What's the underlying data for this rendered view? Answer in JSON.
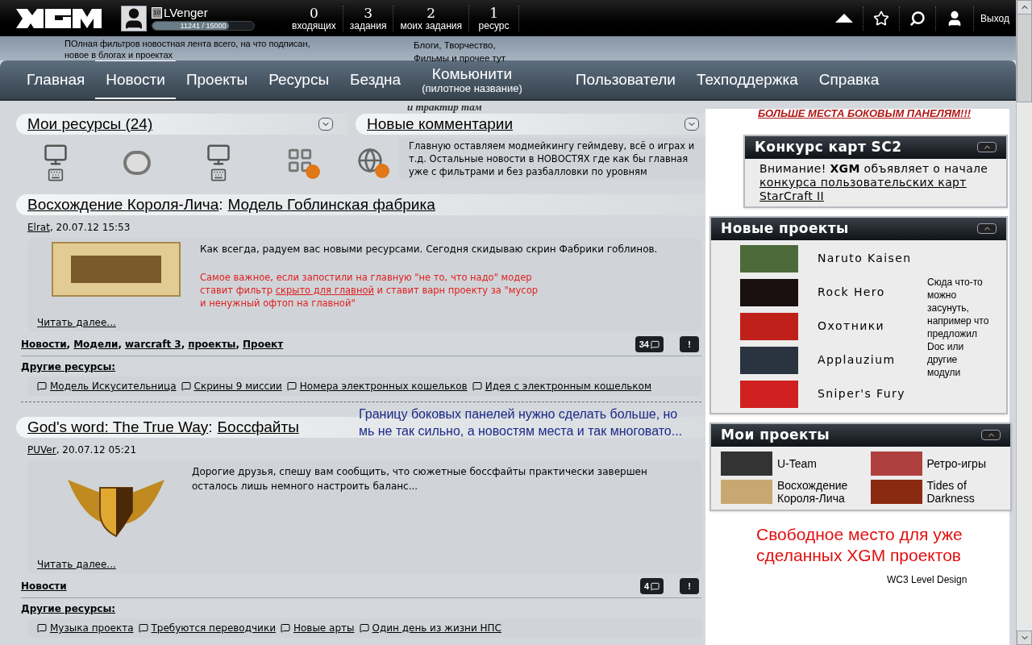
{
  "top_bar": {
    "user": {
      "name": "LVenger",
      "level_badge": "10",
      "xp": "11241 / 15000",
      "level": 0.75
    },
    "stats": [
      {
        "value": "0",
        "label": "входящих"
      },
      {
        "value": "3",
        "label": "задания"
      },
      {
        "value": "2",
        "label": "моих задания"
      },
      {
        "value": "1",
        "label": "ресурс"
      }
    ],
    "logout": "Выход"
  },
  "notes": {
    "news_filter": "ПОлная фильтров новостная лента всего, на что подписан, новое в блогах и проектах",
    "community": "Блоги, Творчество, Фильмы и прочее тут",
    "tavern": "и трактир там",
    "sidebar_space": "БОЛЬШЕ МЕСТА БОКОВЫМ ПАНЕЛЯМ!!!",
    "panel_border": "Границу боковых панелей нужно сделать больше, но мь не так сильно, а новостям места и так многовато...",
    "free_space": "Свободное место для уже сделанных XGM проектов",
    "modules": "Сюда что-то можно засунуть, например что предложил Doc или другие модули"
  },
  "nav": [
    {
      "label": "Главная",
      "selected": false
    },
    {
      "label": "Новости",
      "selected": true
    },
    {
      "label": "Проекты",
      "selected": false
    },
    {
      "label": "Ресурсы",
      "selected": false
    },
    {
      "label": "Бездна",
      "selected": false
    },
    {
      "label": "Комьюнити",
      "subtitle": "(пилотное название)",
      "selected": false
    },
    {
      "label": "Пользователи",
      "selected": false
    },
    {
      "label": "Техподдержка",
      "selected": false
    },
    {
      "label": "Справка",
      "selected": false
    }
  ],
  "resources_widget": {
    "title": "Мои ресурсы (24)"
  },
  "comments_widget": {
    "title": "Новые комментарии",
    "note": "Главную оставляем модмейкингу геймдеву, всё о играх и т.д. Остальные новости в НОВОСТЯХ где как бы главная уже с фильтрами и без разбалловки по уровням"
  },
  "news": [
    {
      "project": "Восхождение Короля-Лича",
      "item": "Модель Гоблинская фабрика",
      "author": "Elrat",
      "date": ", 20.07.12 15:53",
      "kind": "banner",
      "separator": ":",
      "tag_separator": ",",
      "text": "Как всегда, радуем вас новыми ресурсами. Сегодня скидываю скрин Фабрики гоблинов.",
      "note_before": "Самое важное, если запостили на главную \"не то, что надо\" модер ставит фильтр ",
      "note_link": "скрыто для главной",
      "note_after": " и ставит варн проекту за \"мусор и ненужный офтоп на главной\"",
      "read_more": "Читать далее...",
      "tags": [
        "Новости",
        "Модели",
        "warcraft 3",
        "проекты",
        "Проект"
      ],
      "comments": "34",
      "flag": "!",
      "other_label": "Другие ресурсы:",
      "others": [
        "Модель Искусительница",
        "Скрины 9 миссии",
        "Номера электронных кошельков",
        "Идея с электронным кошельком"
      ]
    },
    {
      "project": "God's word: The True Way",
      "item": "Боссфайты",
      "author": "PUVer",
      "date": ", 20.07.12 05:21",
      "kind": "emblem",
      "separator": ":",
      "text": "Дорогие друзья, спешу вам сообщить, что сюжетные боссфайты практически завершен осталось лишь немного настроить баланс...",
      "read_more": "Читать далее...",
      "tags": [
        "Новости"
      ],
      "comments": "4",
      "flag": "!",
      "other_label": "Другие ресурсы:",
      "others": [
        "Музыка проекта",
        "Требуются переводчики",
        "Новые арты",
        "Один день из жизни НПС"
      ]
    }
  ],
  "contest_panel": {
    "title": "Конкурс карт SC2",
    "text": "Внимание! **XGM** объявляет о начале ",
    "link": "конкурса пользовательских карт StarCraft II"
  },
  "new_projects": {
    "title": "Новые проекты",
    "items": [
      {
        "name": "Naruto Kaisen",
        "color": "#4d6a3a"
      },
      {
        "name": "Rock Hero",
        "color": "#1a1010"
      },
      {
        "name": "Охотники",
        "color": "#c0201a"
      },
      {
        "name": "Applauzium",
        "color": "#2a3440"
      },
      {
        "name": "Sniper's Fury",
        "color": "#d02020"
      }
    ]
  },
  "my_projects": {
    "title": "Мои проекты",
    "items": [
      {
        "name": "U-Team",
        "color": "#333333"
      },
      {
        "name": "Ретро-игры",
        "color": "#b04040"
      },
      {
        "name": "Восхождение Короля-Лича",
        "color": "#c8a870"
      },
      {
        "name": "Tides of Darkness",
        "color": "#8a2a10"
      }
    ]
  },
  "trailing_item": "WC3 Level Design"
}
